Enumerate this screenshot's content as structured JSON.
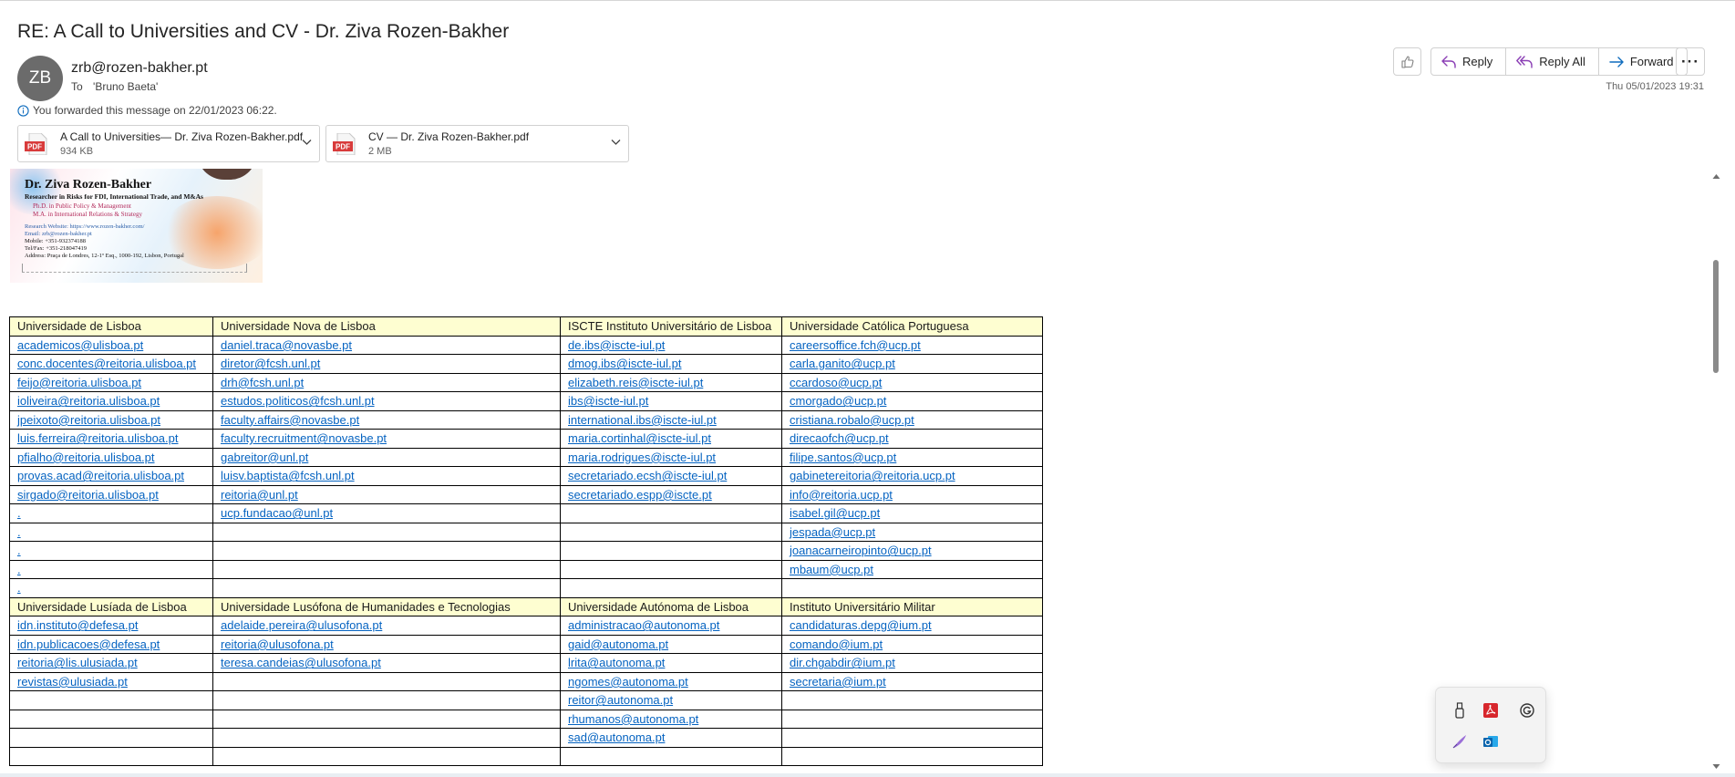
{
  "message": {
    "subject": "RE: A Call to Universities and CV - Dr. Ziva Rozen-Bakher",
    "avatar_initials": "ZB",
    "from": "zrb@rozen-bakher.pt",
    "to_label": "To",
    "to": "'Bruno Baeta'",
    "forward_notice": "You forwarded this message on 22/01/2023 06:22.",
    "date": "Thu 05/01/2023 19:31"
  },
  "actions": {
    "reply": "Reply",
    "reply_all": "Reply All",
    "forward": "Forward"
  },
  "attachments": [
    {
      "name": "A Call to Universities— Dr. Ziva Rozen-Bakher.pdf",
      "size": "934 KB",
      "icon": "pdf-icon"
    },
    {
      "name": "CV — Dr. Ziva Rozen-Bakher.pdf",
      "size": "2 MB",
      "icon": "pdf-icon"
    }
  ],
  "signature": {
    "name": "Dr. Ziva Rozen-Bakher",
    "role": "Researcher in Risks for FDI, International Trade, and M&As",
    "degree1": "Ph.D. in Public Policy & Management",
    "degree2": "M.A. in International Relations & Strategy",
    "website": "Research Website: https://www.rozen-bakher.com/",
    "email": "Email: zrb@rozen-bakher.pt",
    "mobile": "Mobile: +351-932374188",
    "telfax": "Tel/Fax: +351-218047419",
    "address": "Address: Praça de Londres, 12-1º Esq., 1000-192, Lisbon, Portugal"
  },
  "directory": {
    "blocks": [
      {
        "headers": [
          "Universidade de Lisboa",
          "Universidade Nova de Lisboa",
          "ISCTE Instituto Universitário de Lisboa",
          "Universidade Católica Portuguesa"
        ],
        "rows": [
          [
            "academicos@ulisboa.pt",
            "daniel.traca@novasbe.pt",
            "de.ibs@iscte-iul.pt",
            "careersoffice.fch@ucp.pt"
          ],
          [
            "conc.docentes@reitoria.ulisboa.pt",
            "diretor@fcsh.unl.pt",
            "dmog.ibs@iscte-iul.pt",
            "carla.ganito@ucp.pt"
          ],
          [
            "feijo@reitoria.ulisboa.pt",
            "drh@fcsh.unl.pt",
            "elizabeth.reis@iscte-iul.pt",
            "ccardoso@ucp.pt"
          ],
          [
            "ioliveira@reitoria.ulisboa.pt",
            "estudos.politicos@fcsh.unl.pt",
            "ibs@iscte-iul.pt",
            "cmorgado@ucp.pt"
          ],
          [
            "jpeixoto@reitoria.ulisboa.pt",
            "faculty.affairs@novasbe.pt",
            "international.ibs@iscte-iul.pt",
            "cristiana.robalo@ucp.pt"
          ],
          [
            "luis.ferreira@reitoria.ulisboa.pt",
            "faculty.recruitment@novasbe.pt",
            "maria.cortinhal@iscte-iul.pt",
            "direcaofch@ucp.pt"
          ],
          [
            "pfialho@reitoria.ulisboa.pt",
            "gabreitor@unl.pt",
            "maria.rodrigues@iscte-iul.pt",
            "filipe.santos@ucp.pt"
          ],
          [
            "provas.acad@reitoria.ulisboa.pt",
            "luisv.baptista@fcsh.unl.pt",
            "secretariado.ecsh@iscte-iul.pt",
            "gabinetereitoria@reitoria.ucp.pt"
          ],
          [
            "sirgado@reitoria.ulisboa.pt",
            "reitoria@unl.pt",
            "secretariado.espp@iscte.pt",
            "info@reitoria.ucp.pt"
          ],
          [
            ".",
            "ucp.fundacao@unl.pt",
            "",
            "isabel.gil@ucp.pt"
          ],
          [
            ".",
            "",
            "",
            "jespada@ucp.pt"
          ],
          [
            ".",
            "",
            "",
            "joanacarneiropinto@ucp.pt"
          ],
          [
            ".",
            "",
            "",
            "mbaum@ucp.pt"
          ],
          [
            ".",
            "",
            "",
            ""
          ]
        ]
      },
      {
        "headers": [
          "Universidade Lusíada de Lisboa",
          "Universidade Lusófona de Humanidades e Tecnologias",
          "Universidade Autónoma de Lisboa",
          "Instituto Universitário Militar"
        ],
        "rows": [
          [
            "idn.instituto@defesa.pt",
            "adelaide.pereira@ulusofona.pt",
            "administracao@autonoma.pt",
            "candidaturas.depg@ium.pt"
          ],
          [
            "idn.publicacoes@defesa.pt",
            "reitoria@ulusofona.pt",
            "gaid@autonoma.pt",
            "comando@ium.pt"
          ],
          [
            "reitoria@lis.ulusiada.pt",
            "teresa.candeias@ulusofona.pt",
            "lrita@autonoma.pt",
            "dir.chgabdir@ium.pt"
          ],
          [
            "revistas@ulusiada.pt",
            "",
            "ngomes@autonoma.pt",
            "secretaria@ium.pt"
          ],
          [
            "",
            "",
            "reitor@autonoma.pt",
            ""
          ],
          [
            "",
            "",
            "rhumanos@autonoma.pt",
            ""
          ],
          [
            "",
            "",
            "sad@autonoma.pt",
            ""
          ],
          [
            "",
            "",
            "",
            ""
          ]
        ]
      }
    ]
  },
  "tray_flyout": {
    "icons": [
      "usb-drive-icon",
      "acrobat-icon",
      "grammarly-icon",
      "pen-icon",
      "outlook-icon"
    ]
  },
  "colors": {
    "link": "#0563c1",
    "header_fill": "#fefed1",
    "accent": "#0f6cbd",
    "reply_all": "#8b3fb5"
  }
}
